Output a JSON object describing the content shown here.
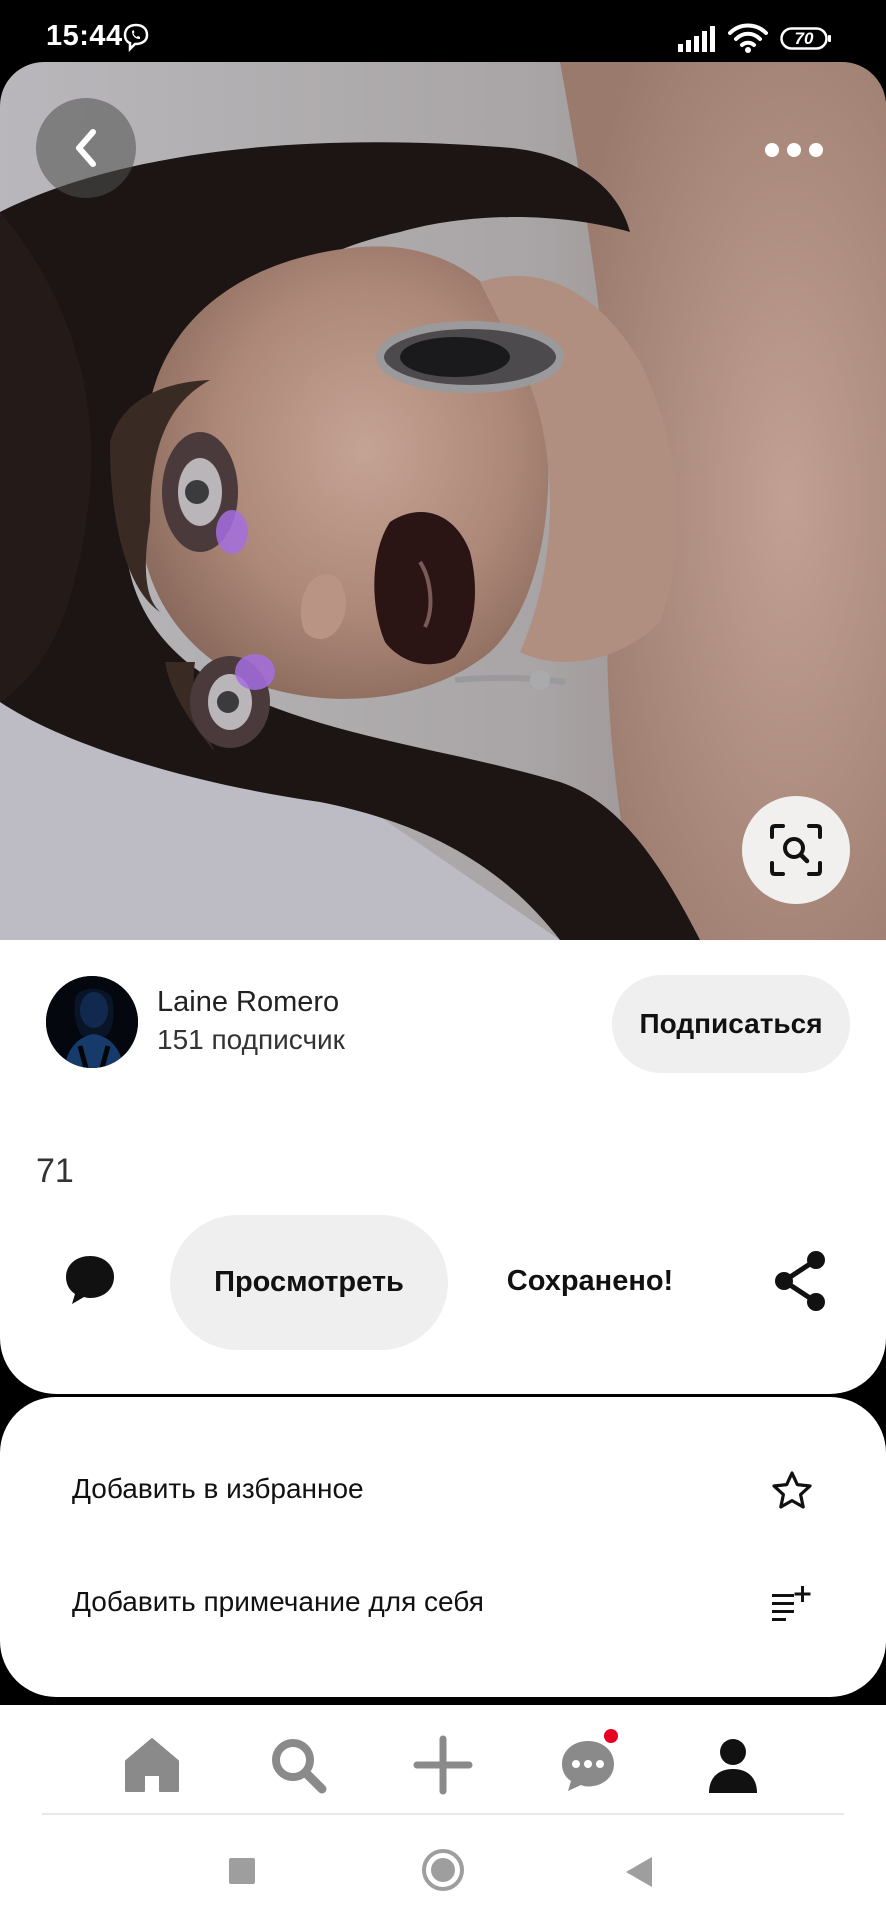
{
  "status_bar": {
    "time": "15:44",
    "battery": "70",
    "icons": [
      "viber-icon",
      "signal-icon",
      "wifi-icon",
      "battery-icon"
    ]
  },
  "pin": {
    "image_subject": "portrait photo (rotated) of woman with dark lipstick and purple eyeshadow",
    "top_icons": [
      "back-arrow-icon",
      "more-dots-icon"
    ],
    "lens_icon": "visual-search-icon"
  },
  "author": {
    "name": "Laine Romero",
    "followers": "151 подписчик",
    "subscribe_label": "Подписаться"
  },
  "reactions": {
    "count": "71"
  },
  "actions": {
    "view_label": "Просмотреть",
    "saved_label": "Сохранено!",
    "icons": [
      "comment-icon",
      "share-icon"
    ]
  },
  "options": [
    {
      "label": "Добавить в избранное",
      "icon": "star-icon"
    },
    {
      "label": "Добавить примечание для себя",
      "icon": "note-add-icon"
    }
  ],
  "bottom_nav": {
    "items": [
      "home-icon",
      "search-icon",
      "create-icon",
      "messages-icon",
      "profile-icon"
    ],
    "badge_color": "#e60023"
  },
  "system_nav": [
    "recents-icon",
    "home-circle-icon",
    "back-triangle-icon"
  ]
}
